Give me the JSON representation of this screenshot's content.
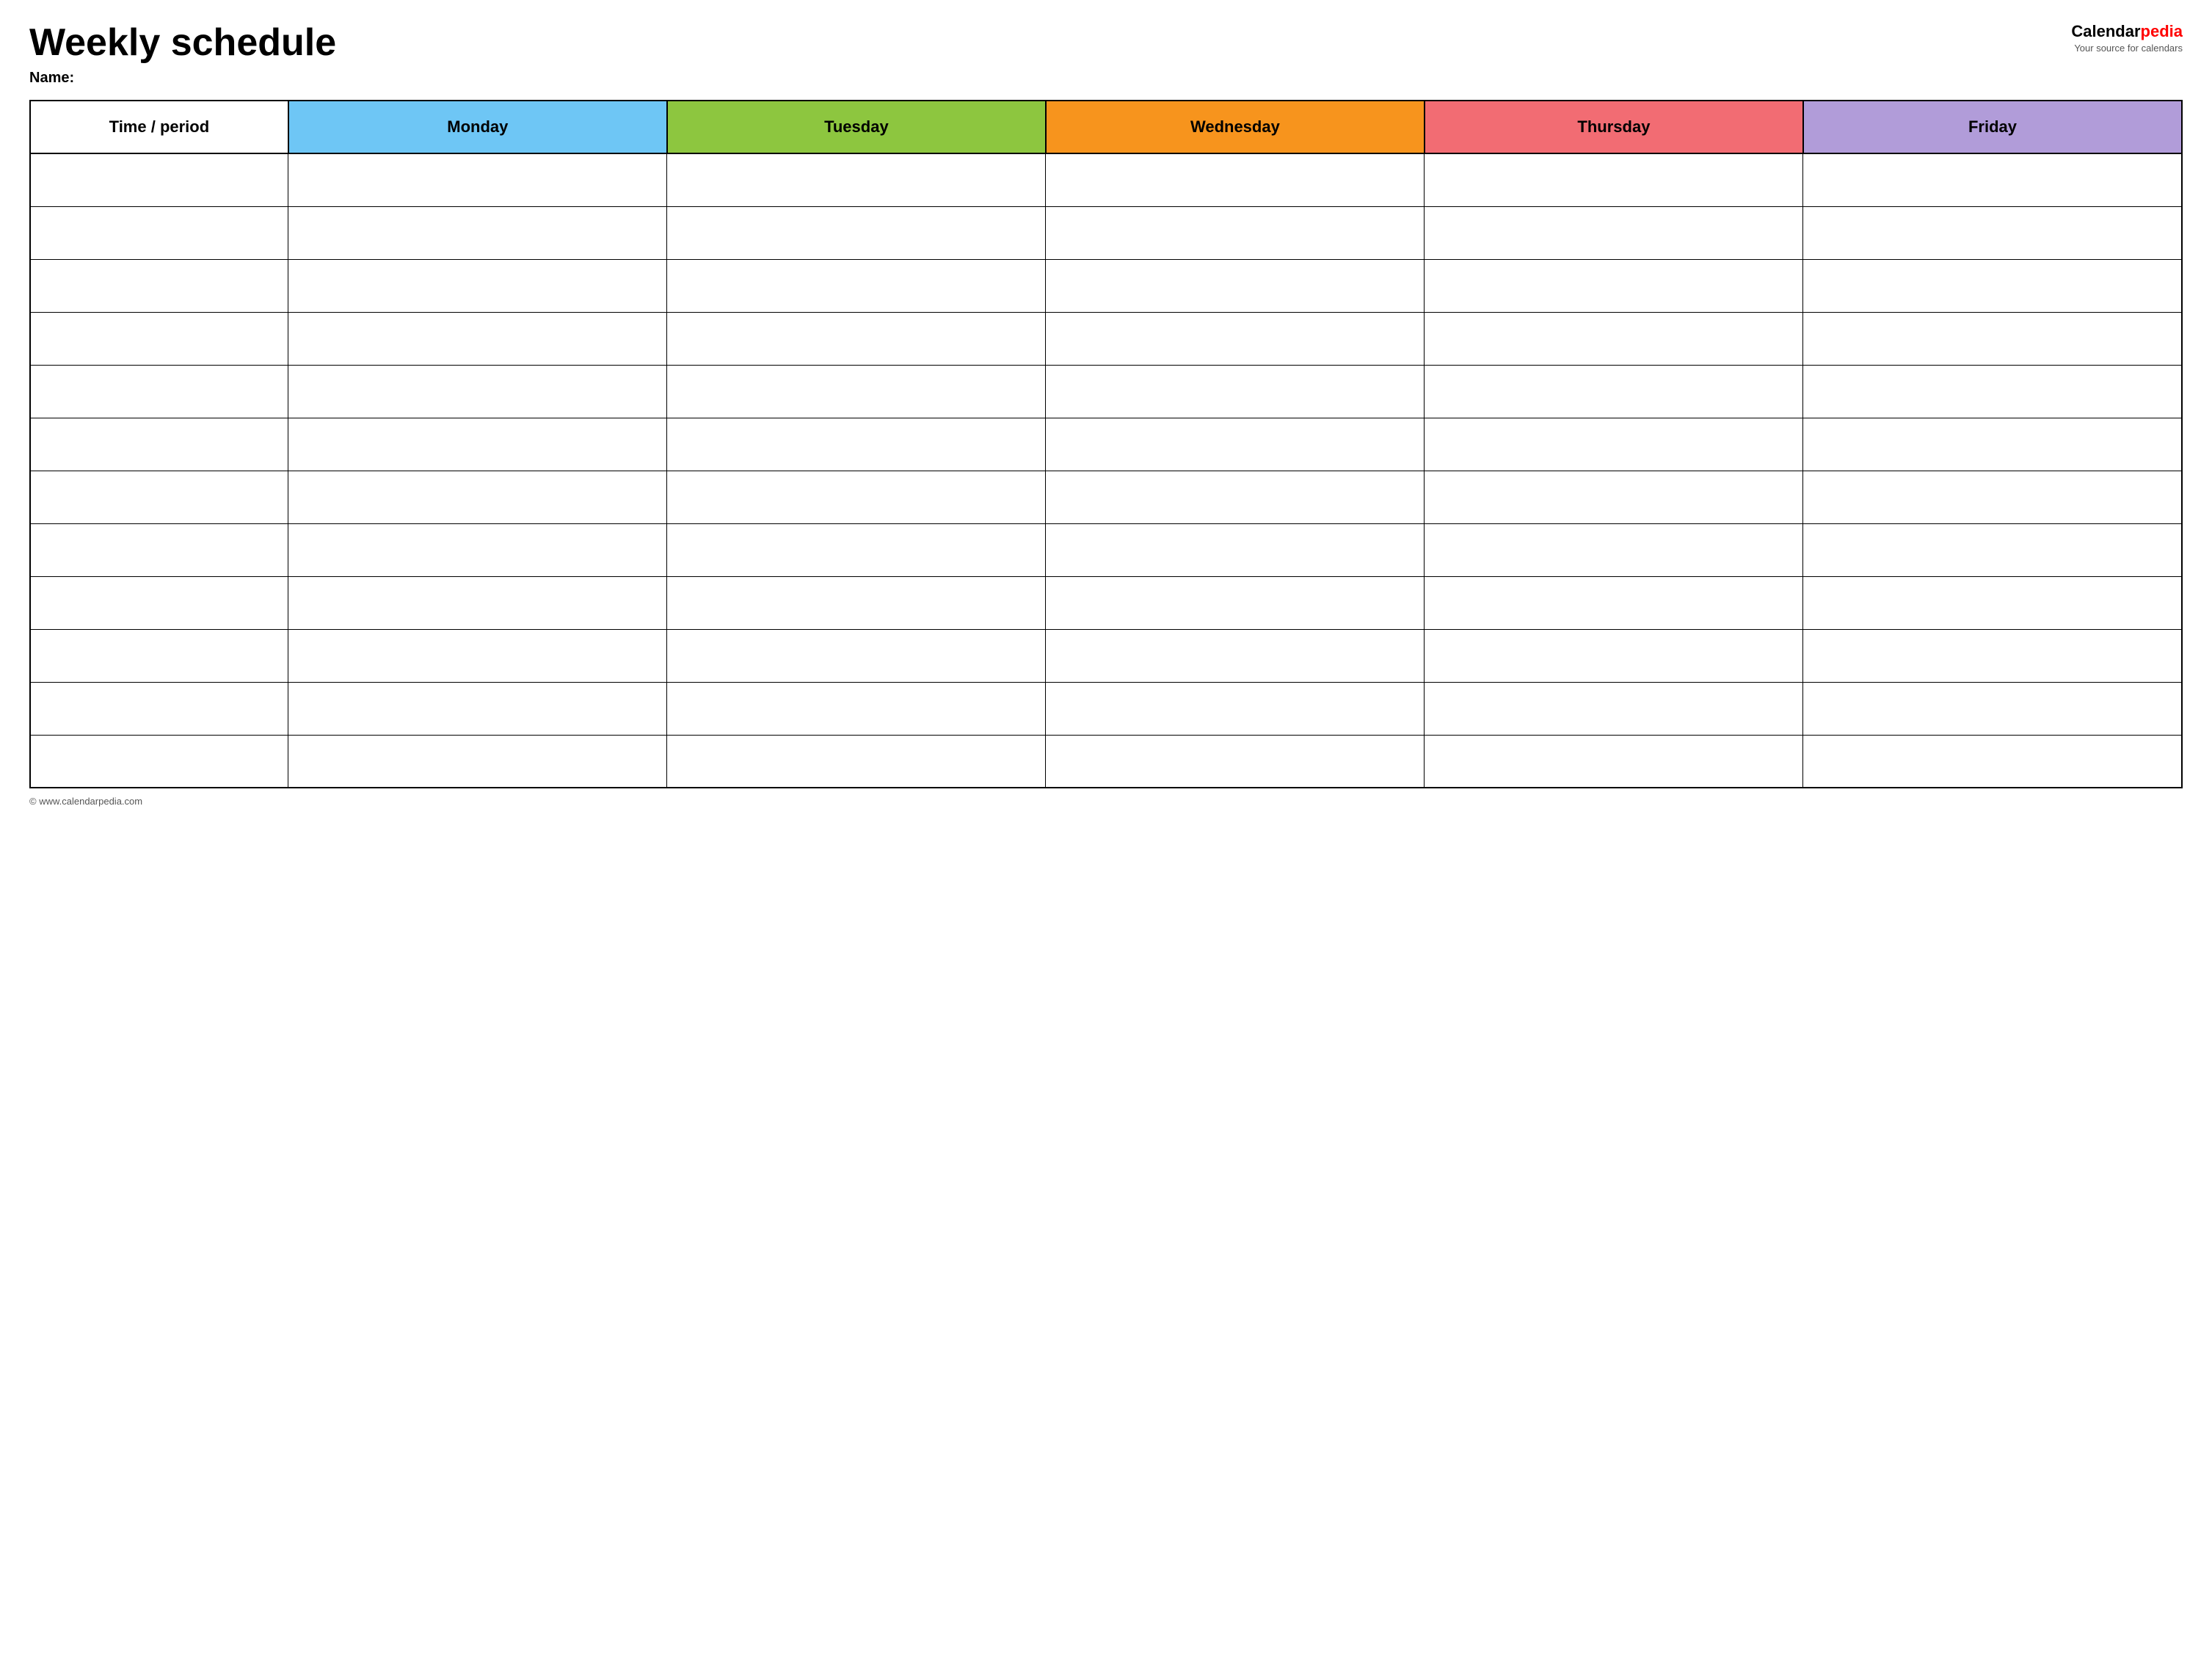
{
  "header": {
    "title": "Weekly schedule",
    "name_label": "Name:",
    "logo": {
      "brand_black": "Calendar",
      "brand_red": "pedia",
      "subtitle": "Your source for calendars"
    }
  },
  "table": {
    "columns": [
      {
        "key": "time",
        "label": "Time / period",
        "color": "#ffffff"
      },
      {
        "key": "monday",
        "label": "Monday",
        "color": "#6ec6f5"
      },
      {
        "key": "tuesday",
        "label": "Tuesday",
        "color": "#8dc63f"
      },
      {
        "key": "wednesday",
        "label": "Wednesday",
        "color": "#f7941d"
      },
      {
        "key": "thursday",
        "label": "Thursday",
        "color": "#f26c73"
      },
      {
        "key": "friday",
        "label": "Friday",
        "color": "#b19cd9"
      }
    ],
    "row_count": 12
  },
  "footer": {
    "url": "© www.calendarpedia.com"
  }
}
